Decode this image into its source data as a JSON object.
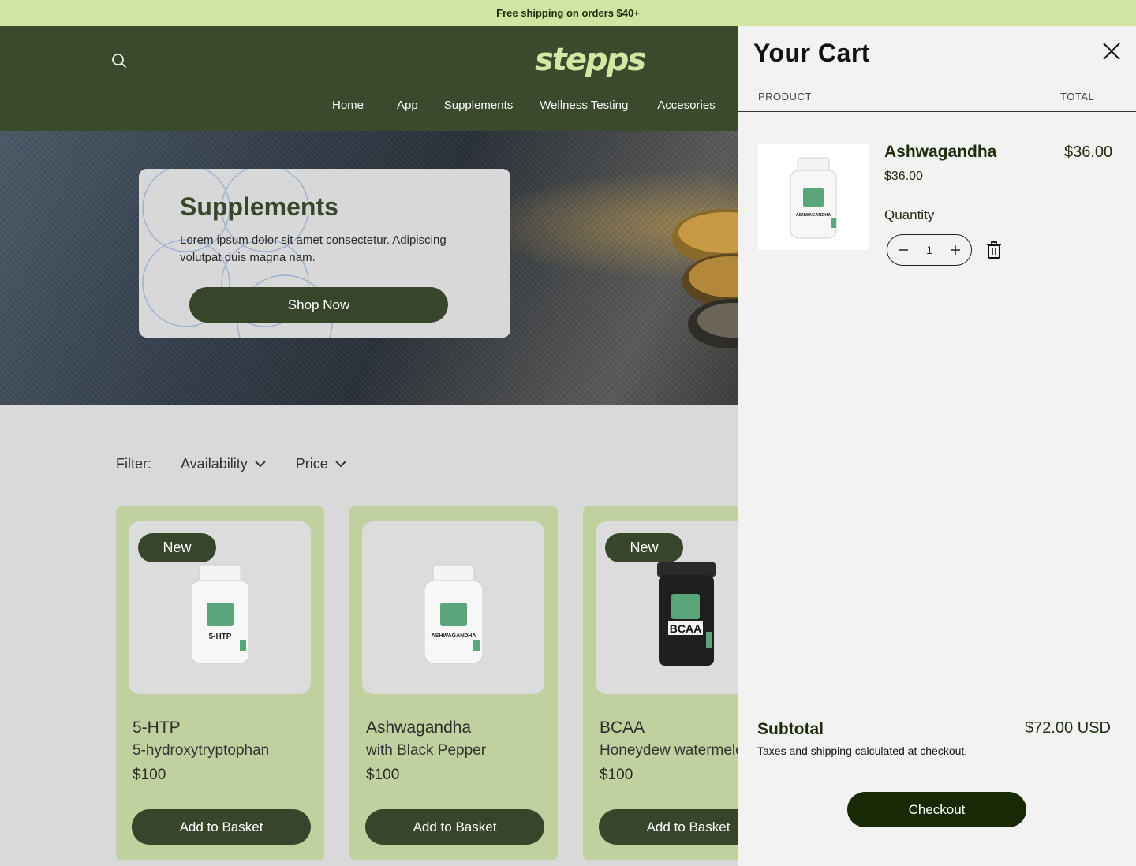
{
  "announcement": "Free shipping on orders $40+",
  "header": {
    "logo_text": "stepps",
    "nav": [
      "Home",
      "App",
      "Supplements",
      "Wellness Testing",
      "Accesories"
    ]
  },
  "hero": {
    "title": "Supplements",
    "text": "Lorem ipsum dolor sit amet consectetur. Adipiscing volutpat duis magna nam.",
    "cta": "Shop Now"
  },
  "filter": {
    "label": "Filter:",
    "options": [
      "Availability",
      "Price"
    ]
  },
  "products": [
    {
      "badge": "New",
      "name": "5-HTP",
      "subtitle": "5-hydroxytryptophan",
      "price": "$100",
      "cta": "Add to Basket",
      "label_text": "5-HTP"
    },
    {
      "badge": "",
      "name": "Ashwagandha",
      "subtitle": "with Black Pepper",
      "price": "$100",
      "cta": "Add to Basket",
      "label_text": "ASHWAGANDHA"
    },
    {
      "badge": "New",
      "name": "BCAA",
      "subtitle": "Honeydew watermelon",
      "price": "$100",
      "cta": "Add to Basket",
      "label_text": "BCAA"
    }
  ],
  "cart": {
    "title": "Your Cart",
    "col_product": "PRODUCT",
    "col_total": "TOTAL",
    "item": {
      "name": "Ashwagandha",
      "unit_price": "$36.00",
      "total": "$36.00",
      "quantity_label": "Quantity",
      "quantity": "1",
      "label_text": "ASHWAGANDHA"
    },
    "subtotal_label": "Subtotal",
    "subtotal_value": "$72.00 USD",
    "tax_note": "Taxes and shipping calculated at checkout.",
    "checkout": "Checkout"
  },
  "colors": {
    "announcement_bg": "#cfe5a1",
    "header_bg": "#3a4a2c",
    "brand_dark": "#37452a",
    "card_bg": "#c0d09e",
    "checkout_bg": "#172a05"
  }
}
